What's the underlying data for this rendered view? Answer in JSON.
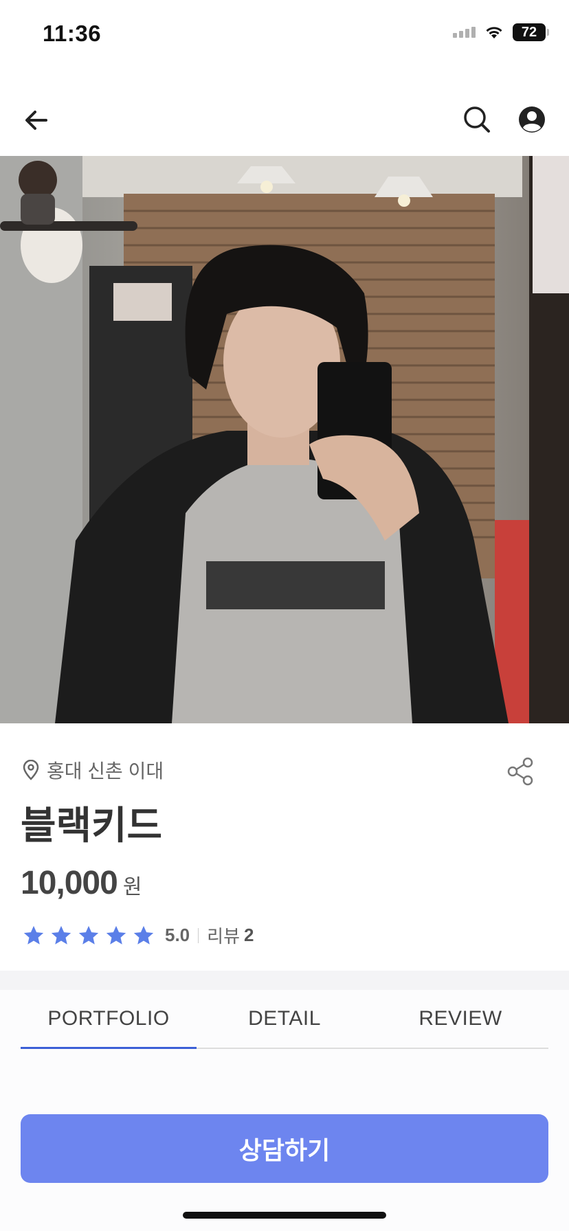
{
  "status_bar": {
    "time": "11:36",
    "battery": "72"
  },
  "header": {
    "back_icon": "arrow-left-icon",
    "search_icon": "search-icon",
    "profile_icon": "user-circle-icon"
  },
  "hero": {
    "icon": "photo"
  },
  "info": {
    "location": "홍대 신촌 이대",
    "title": "블랙키드",
    "price": "10,000",
    "price_unit": "원",
    "rating": {
      "stars": 5,
      "score": "5.0",
      "review_label": "리뷰",
      "review_count": "2"
    }
  },
  "tabs": [
    {
      "label": "PORTFOLIO",
      "active": true
    },
    {
      "label": "DETAIL",
      "active": false
    },
    {
      "label": "REVIEW",
      "active": false
    }
  ],
  "cta": {
    "label": "상담하기"
  },
  "colors": {
    "accent": "#6d85ef",
    "star": "#5b7fe8",
    "tab_indicator": "#3b5fd6"
  }
}
